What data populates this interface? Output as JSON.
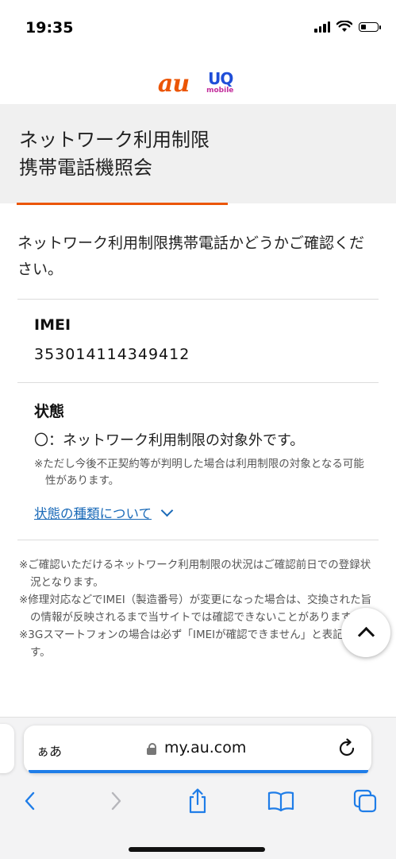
{
  "status_bar": {
    "time": "19:35"
  },
  "logos": {
    "au": "au",
    "uq_top": "UQ",
    "uq_bottom": "mobile"
  },
  "header": {
    "title": "ネットワーク利用制限\n携帯電話機照会"
  },
  "intro": "ネットワーク利用制限携帯電話かどうかご確認ください。",
  "imei": {
    "label": "IMEI",
    "value": "353014114349412"
  },
  "state": {
    "label": "状態",
    "value": "〇：ネットワーク利用制限の対象外です。",
    "note": "※ただし今後不正契約等が判明した場合は利用制限の対象となる可能性があります。",
    "link_label": "状態の種類について"
  },
  "notes": [
    "※ご確認いただけるネットワーク利用制限の状況はご確認前日での登録状況となります。",
    "※修理対応などでIMEI（製造番号）が変更になった場合は、交換された旨の情報が反映されるまで当サイトでは確認できないことがあります。",
    "※3Gスマートフォンの場合は必ず「IMEIが確認できません」と表記されます。"
  ],
  "browser": {
    "reader_label": "ぁあ",
    "url": "my.au.com",
    "accent_color": "#1f7de8"
  },
  "colors": {
    "au_orange": "#eb5505",
    "link_blue": "#1a6ab8"
  }
}
